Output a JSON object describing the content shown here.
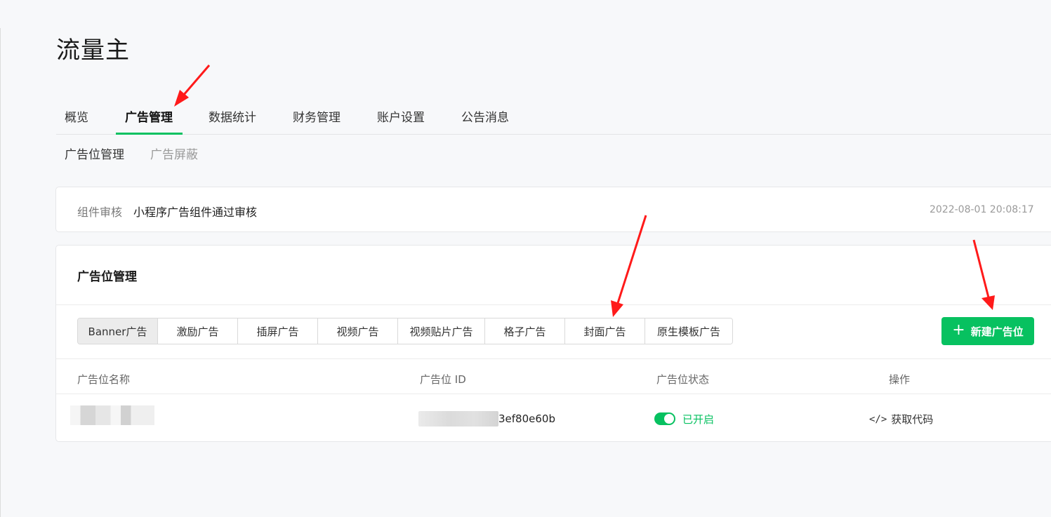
{
  "page": {
    "title": "流量主"
  },
  "main_nav": {
    "tabs": [
      {
        "label": "概览"
      },
      {
        "label": "广告管理",
        "active": true
      },
      {
        "label": "数据统计"
      },
      {
        "label": "财务管理"
      },
      {
        "label": "账户设置"
      },
      {
        "label": "公告消息"
      }
    ]
  },
  "sub_nav": {
    "items": [
      {
        "label": "广告位管理",
        "active": true
      },
      {
        "label": "广告屏蔽"
      }
    ]
  },
  "notice": {
    "label": "组件审核",
    "text": "小程序广告组件通过审核",
    "time": "2022-08-01 20:08:17"
  },
  "ad_card": {
    "title": "广告位管理",
    "types": [
      {
        "label": "Banner广告",
        "active": true
      },
      {
        "label": "激励广告"
      },
      {
        "label": "插屏广告"
      },
      {
        "label": "视频广告"
      },
      {
        "label": "视频贴片广告"
      },
      {
        "label": "格子广告"
      },
      {
        "label": "封面广告"
      },
      {
        "label": "原生模板广告"
      }
    ],
    "new_button": {
      "icon": "plus-icon",
      "label": "新建广告位"
    },
    "table": {
      "headers": [
        "广告位名称",
        "广告位 ID",
        "广告位状态",
        "操作"
      ],
      "rows": [
        {
          "id_visible": "3ef80e60b",
          "status": "已开启",
          "action": "获取代码",
          "action_icon": "code-icon"
        }
      ]
    }
  },
  "colors": {
    "accent": "#07c160",
    "annotation": "#ff1a1a"
  }
}
